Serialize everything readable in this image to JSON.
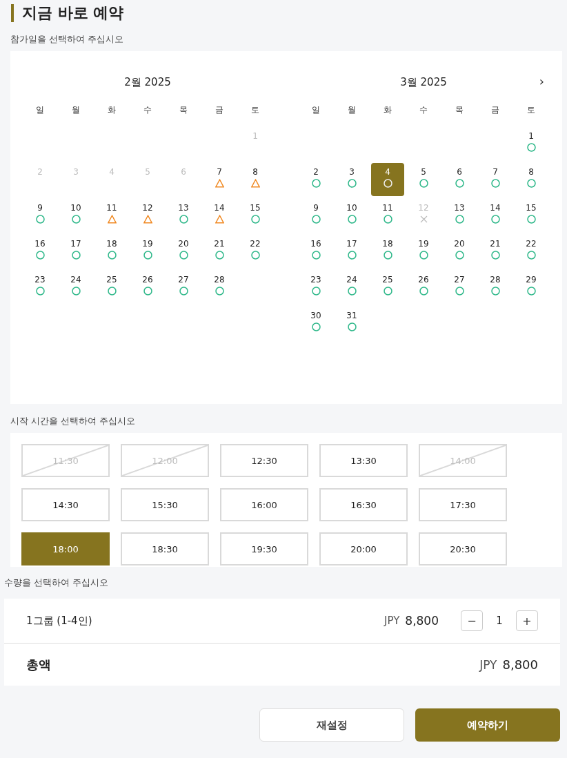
{
  "title": "지금 바로 예약",
  "date_section": {
    "label": "참가일을 선택하여 주십시오",
    "next": "›",
    "months": [
      {
        "title": "2월 2025",
        "weekdays": [
          "일",
          "월",
          "화",
          "수",
          "목",
          "금",
          "토"
        ],
        "weeks": [
          [
            {
              "kind": "blank"
            },
            {
              "kind": "blank"
            },
            {
              "kind": "blank"
            },
            {
              "kind": "blank"
            },
            {
              "kind": "blank"
            },
            {
              "kind": "blank"
            },
            {
              "label": "1",
              "kind": "past",
              "selected": false
            }
          ],
          [
            {
              "label": "2",
              "kind": "past",
              "selected": false
            },
            {
              "label": "3",
              "kind": "past",
              "selected": false
            },
            {
              "label": "4",
              "kind": "past",
              "selected": false
            },
            {
              "label": "5",
              "kind": "past",
              "selected": false
            },
            {
              "label": "6",
              "kind": "past",
              "selected": false
            },
            {
              "label": "7",
              "kind": "few",
              "selected": false
            },
            {
              "label": "8",
              "kind": "few",
              "selected": false
            }
          ],
          [
            {
              "label": "9",
              "kind": "open",
              "selected": false
            },
            {
              "label": "10",
              "kind": "open",
              "selected": false
            },
            {
              "label": "11",
              "kind": "few",
              "selected": false
            },
            {
              "label": "12",
              "kind": "few",
              "selected": false
            },
            {
              "label": "13",
              "kind": "open",
              "selected": false
            },
            {
              "label": "14",
              "kind": "few",
              "selected": false
            },
            {
              "label": "15",
              "kind": "open",
              "selected": false
            }
          ],
          [
            {
              "label": "16",
              "kind": "open",
              "selected": false
            },
            {
              "label": "17",
              "kind": "open",
              "selected": false
            },
            {
              "label": "18",
              "kind": "open",
              "selected": false
            },
            {
              "label": "19",
              "kind": "open",
              "selected": false
            },
            {
              "label": "20",
              "kind": "open",
              "selected": false
            },
            {
              "label": "21",
              "kind": "open",
              "selected": false
            },
            {
              "label": "22",
              "kind": "open",
              "selected": false
            }
          ],
          [
            {
              "label": "23",
              "kind": "open",
              "selected": false
            },
            {
              "label": "24",
              "kind": "open",
              "selected": false
            },
            {
              "label": "25",
              "kind": "open",
              "selected": false
            },
            {
              "label": "26",
              "kind": "open",
              "selected": false
            },
            {
              "label": "27",
              "kind": "open",
              "selected": false
            },
            {
              "label": "28",
              "kind": "open",
              "selected": false
            }
          ]
        ]
      },
      {
        "title": "3월 2025",
        "weekdays": [
          "일",
          "월",
          "화",
          "수",
          "목",
          "금",
          "토"
        ],
        "weeks": [
          [
            {
              "kind": "blank"
            },
            {
              "kind": "blank"
            },
            {
              "kind": "blank"
            },
            {
              "kind": "blank"
            },
            {
              "kind": "blank"
            },
            {
              "kind": "blank"
            },
            {
              "label": "1",
              "kind": "open",
              "selected": false
            }
          ],
          [
            {
              "label": "2",
              "kind": "open",
              "selected": false
            },
            {
              "label": "3",
              "kind": "open",
              "selected": false
            },
            {
              "label": "4",
              "kind": "open",
              "selected": true
            },
            {
              "label": "5",
              "kind": "open",
              "selected": false
            },
            {
              "label": "6",
              "kind": "open",
              "selected": false
            },
            {
              "label": "7",
              "kind": "open",
              "selected": false
            },
            {
              "label": "8",
              "kind": "open",
              "selected": false
            }
          ],
          [
            {
              "label": "9",
              "kind": "open",
              "selected": false
            },
            {
              "label": "10",
              "kind": "open",
              "selected": false
            },
            {
              "label": "11",
              "kind": "open",
              "selected": false
            },
            {
              "label": "12",
              "kind": "full",
              "selected": false
            },
            {
              "label": "13",
              "kind": "open",
              "selected": false
            },
            {
              "label": "14",
              "kind": "open",
              "selected": false
            },
            {
              "label": "15",
              "kind": "open",
              "selected": false
            }
          ],
          [
            {
              "label": "16",
              "kind": "open",
              "selected": false
            },
            {
              "label": "17",
              "kind": "open",
              "selected": false
            },
            {
              "label": "18",
              "kind": "open",
              "selected": false
            },
            {
              "label": "19",
              "kind": "open",
              "selected": false
            },
            {
              "label": "20",
              "kind": "open",
              "selected": false
            },
            {
              "label": "21",
              "kind": "open",
              "selected": false
            },
            {
              "label": "22",
              "kind": "open",
              "selected": false
            }
          ],
          [
            {
              "label": "23",
              "kind": "open",
              "selected": false
            },
            {
              "label": "24",
              "kind": "open",
              "selected": false
            },
            {
              "label": "25",
              "kind": "open",
              "selected": false
            },
            {
              "label": "26",
              "kind": "open",
              "selected": false
            },
            {
              "label": "27",
              "kind": "open",
              "selected": false
            },
            {
              "label": "28",
              "kind": "open",
              "selected": false
            },
            {
              "label": "29",
              "kind": "open",
              "selected": false
            }
          ],
          [
            {
              "label": "30",
              "kind": "open",
              "selected": false
            },
            {
              "label": "31",
              "kind": "open",
              "selected": false
            }
          ]
        ]
      }
    ]
  },
  "time_section": {
    "label": "시작 시간을 선택하여 주십시오",
    "slots": [
      {
        "label": "11:30",
        "disabled": true,
        "selected": false
      },
      {
        "label": "12:00",
        "disabled": true,
        "selected": false
      },
      {
        "label": "12:30",
        "disabled": false,
        "selected": false
      },
      {
        "label": "13:30",
        "disabled": false,
        "selected": false
      },
      {
        "label": "14:00",
        "disabled": true,
        "selected": false
      },
      {
        "label": "14:30",
        "disabled": false,
        "selected": false
      },
      {
        "label": "15:30",
        "disabled": false,
        "selected": false
      },
      {
        "label": "16:00",
        "disabled": false,
        "selected": false
      },
      {
        "label": "16:30",
        "disabled": false,
        "selected": false
      },
      {
        "label": "17:30",
        "disabled": false,
        "selected": false
      },
      {
        "label": "18:00",
        "disabled": false,
        "selected": true
      },
      {
        "label": "18:30",
        "disabled": false,
        "selected": false
      },
      {
        "label": "19:30",
        "disabled": false,
        "selected": false
      },
      {
        "label": "20:00",
        "disabled": false,
        "selected": false
      },
      {
        "label": "20:30",
        "disabled": false,
        "selected": false
      }
    ]
  },
  "quantity_section": {
    "label": "수량을 선택하여 주십시오",
    "items": [
      {
        "name": "1그룹 (1-4인)",
        "currency": "JPY",
        "price": "8,800",
        "minus": "−",
        "count": "1",
        "plus": "+"
      }
    ],
    "total": {
      "label": "총액",
      "currency": "JPY",
      "amount": "8,800"
    }
  },
  "buttons": {
    "reset": "재설정",
    "book": "예약하기"
  }
}
